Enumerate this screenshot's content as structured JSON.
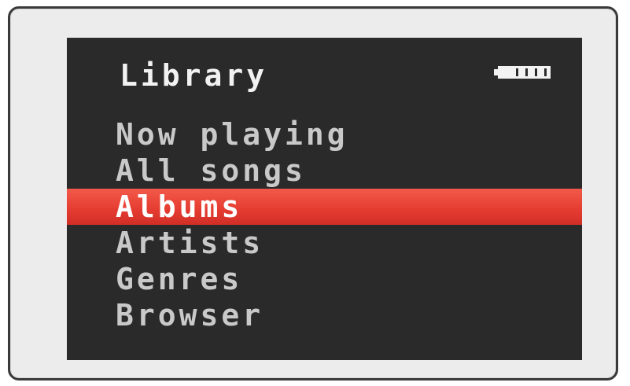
{
  "screen": {
    "title": "Library",
    "battery_icon": "battery-icon"
  },
  "menu": {
    "items": [
      {
        "label": "Now playing",
        "selected": false
      },
      {
        "label": "All songs",
        "selected": false
      },
      {
        "label": "Albums",
        "selected": true
      },
      {
        "label": "Artists",
        "selected": false
      },
      {
        "label": "Genres",
        "selected": false
      },
      {
        "label": "Browser",
        "selected": false
      }
    ]
  },
  "colors": {
    "screen_bg": "#2a2a2a",
    "highlight": "#e63d32",
    "text": "#c9c9c9",
    "selected_text": "#ffffff",
    "bezel": "#ececec"
  }
}
